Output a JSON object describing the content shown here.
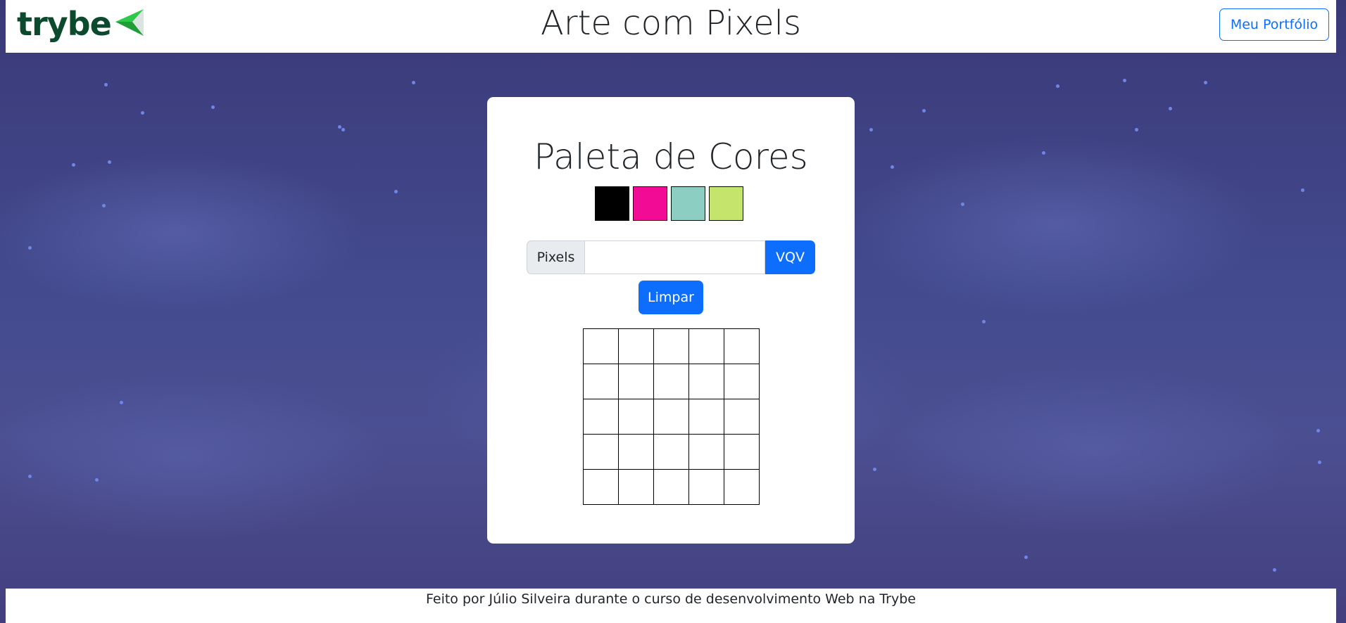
{
  "header": {
    "logo_text": "trybe",
    "title": "Arte com Pixels",
    "portfolio_label": "Meu Portfólio"
  },
  "card": {
    "palette_title": "Paleta de Cores",
    "palette_colors": [
      "#000000",
      "#f20c95",
      "#8ccfc2",
      "#c5e46b"
    ],
    "board_input": {
      "label": "Pixels",
      "value": "",
      "placeholder": "",
      "button_label": "VQV"
    },
    "clear_label": "Limpar",
    "board": {
      "rows": 5,
      "cols": 5
    }
  },
  "footer": {
    "text": "Feito por Júlio Silveira durante o curso de desenvolvimento Web na Trybe"
  },
  "theme": {
    "accent": "#0d6efd",
    "logo_dark": "#0b4a2d",
    "logo_green": "#2fc94a"
  }
}
